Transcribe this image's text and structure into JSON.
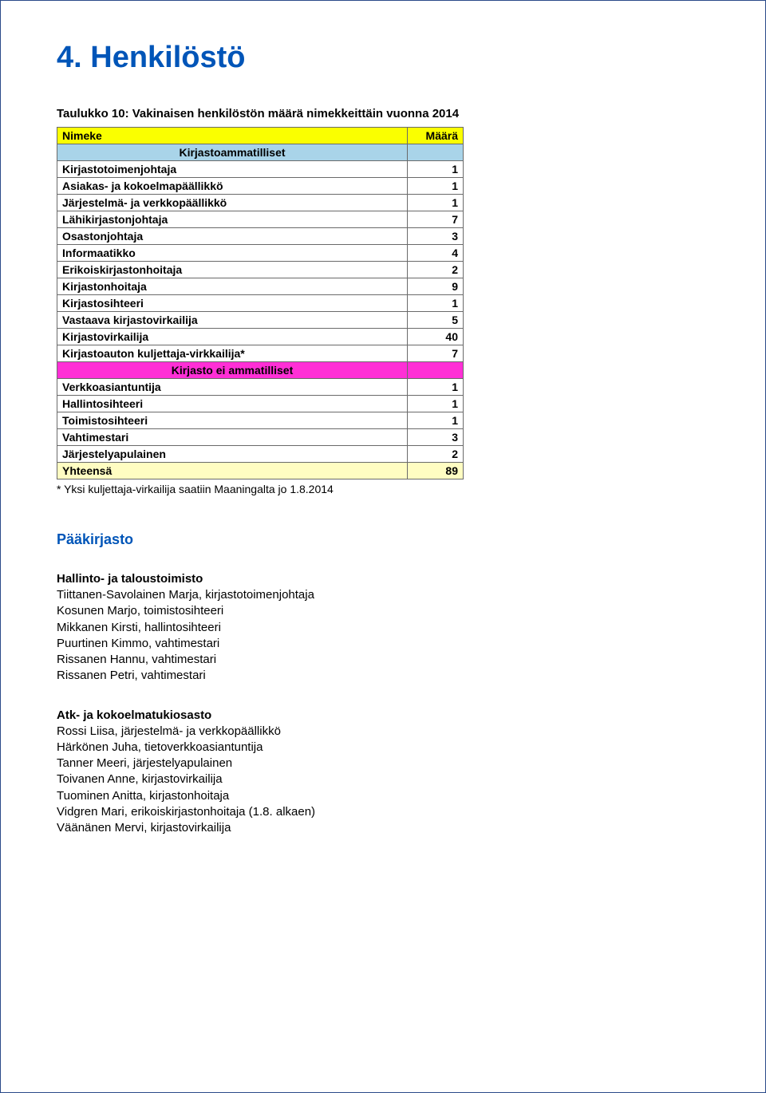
{
  "title": "4. Henkilöstö",
  "table": {
    "caption": "Taulukko 10: Vakinaisen henkilöstön määrä nimekkeittäin vuonna 2014",
    "headers": {
      "col1": "Nimeke",
      "col2": "Määrä"
    },
    "group1_label": "Kirjastoammatilliset",
    "group1_rows": [
      {
        "label": "Kirjastotoimenjohtaja",
        "value": "1"
      },
      {
        "label": "Asiakas- ja kokoelmapäällikkö",
        "value": "1"
      },
      {
        "label": "Järjestelmä- ja verkkopäällikkö",
        "value": "1"
      },
      {
        "label": "Lähikirjastonjohtaja",
        "value": "7"
      },
      {
        "label": "Osastonjohtaja",
        "value": "3"
      },
      {
        "label": "Informaatikko",
        "value": "4"
      },
      {
        "label": "Erikoiskirjastonhoitaja",
        "value": "2"
      },
      {
        "label": "Kirjastonhoitaja",
        "value": "9"
      },
      {
        "label": "Kirjastosihteeri",
        "value": "1"
      },
      {
        "label": "Vastaava kirjastovirkailija",
        "value": "5"
      },
      {
        "label": "Kirjastovirkailija",
        "value": "40"
      },
      {
        "label": "Kirjastoauton kuljettaja-virkkailija*",
        "value": "7"
      }
    ],
    "group2_label": "Kirjasto ei ammatilliset",
    "group2_rows": [
      {
        "label": "Verkkoasiantuntija",
        "value": "1"
      },
      {
        "label": "Hallintosihteeri",
        "value": "1"
      },
      {
        "label": "Toimistosihteeri",
        "value": "1"
      },
      {
        "label": "Vahtimestari",
        "value": "3"
      },
      {
        "label": "Järjestelyapulainen",
        "value": "2"
      }
    ],
    "total_label": "Yhteensä",
    "total_value": "89"
  },
  "footnote": "* Yksi kuljettaja-virkailija saatiin Maaningalta jo 1.8.2014",
  "subsection": "Pääkirjasto",
  "groups": [
    {
      "heading": "Hallinto- ja taloustoimisto",
      "lines": [
        "Tiittanen-Savolainen Marja, kirjastotoimenjohtaja",
        "Kosunen Marjo, toimistosihteeri",
        "Mikkanen Kirsti, hallintosihteeri",
        "Puurtinen Kimmo, vahtimestari",
        "Rissanen Hannu, vahtimestari",
        "Rissanen Petri, vahtimestari"
      ]
    },
    {
      "heading": "Atk- ja kokoelmatukiosasto",
      "lines": [
        "Rossi Liisa, järjestelmä- ja verkkopäällikkö",
        "Härkönen Juha, tietoverkkoasiantuntija",
        "Tanner Meeri, järjestelyapulainen",
        "Toivanen Anne, kirjastovirkailija",
        "Tuominen Anitta, kirjastonhoitaja",
        "Vidgren Mari, erikoiskirjastonhoitaja (1.8. alkaen)",
        "Väänänen Mervi, kirjastovirkailija"
      ]
    }
  ]
}
